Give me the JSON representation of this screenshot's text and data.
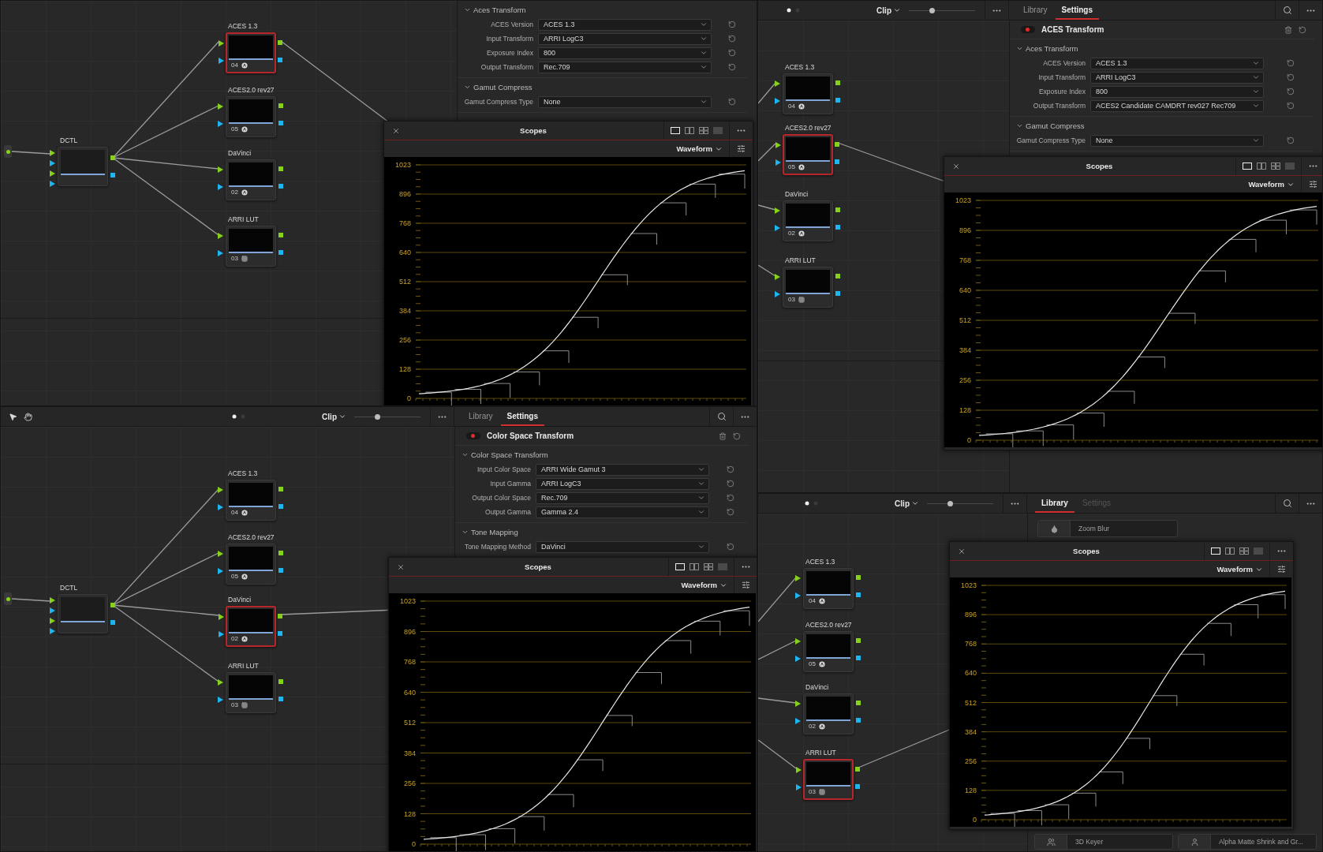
{
  "panels": [
    {
      "node_graph": {
        "source": {
          "label": "DCTL"
        },
        "nodes": [
          {
            "label": "ACES 1.3",
            "number": "04",
            "kind": "effect",
            "selected": true
          },
          {
            "label": "ACES2.0 rev27",
            "number": "05",
            "kind": "effect",
            "selected": false
          },
          {
            "label": "DaVinci",
            "number": "02",
            "kind": "effect",
            "selected": false
          },
          {
            "label": "ARRI LUT",
            "number": "03",
            "kind": "lut",
            "selected": false
          }
        ]
      },
      "settings": {
        "sections": [
          {
            "title": "Aces Transform",
            "expanded": true,
            "fields": [
              {
                "label": "ACES Version",
                "value": "ACES 1.3"
              },
              {
                "label": "Input Transform",
                "value": "ARRI LogC3"
              },
              {
                "label": "Exposure Index",
                "value": "800"
              },
              {
                "label": "Output Transform",
                "value": "Rec.709"
              }
            ]
          },
          {
            "title": "Gamut Compress",
            "expanded": true,
            "fields": [
              {
                "label": "Gamut Compress Type",
                "value": "None"
              }
            ]
          }
        ]
      },
      "scopes": {
        "title": "Scopes",
        "mode": "Waveform",
        "y_labels": [
          "1023",
          "896",
          "768",
          "640",
          "512",
          "384",
          "256",
          "128",
          "0"
        ]
      }
    },
    {
      "toolbar": {
        "view": "Clip",
        "slider": {
          "level": 0.35
        },
        "tabs": [
          {
            "label": "Library",
            "selected": false,
            "disabled": false
          },
          {
            "label": "Settings",
            "selected": true,
            "disabled": false
          }
        ]
      },
      "node_graph": {
        "nodes": [
          {
            "label": "ACES 1.3",
            "number": "04",
            "kind": "effect",
            "selected": false
          },
          {
            "label": "ACES2.0 rev27",
            "number": "05",
            "kind": "effect",
            "selected": true
          },
          {
            "label": "DaVinci",
            "number": "02",
            "kind": "effect",
            "selected": false
          },
          {
            "label": "ARRI LUT",
            "number": "03",
            "kind": "lut",
            "selected": false
          }
        ]
      },
      "settings": {
        "effect": {
          "title": "ACES Transform",
          "enabled": true
        },
        "sections": [
          {
            "title": "Aces Transform",
            "expanded": true,
            "fields": [
              {
                "label": "ACES Version",
                "value": "ACES 1.3"
              },
              {
                "label": "Input Transform",
                "value": "ARRI LogC3"
              },
              {
                "label": "Exposure Index",
                "value": "800"
              },
              {
                "label": "Output Transform",
                "value": "ACES2 Candidate CAMDRT rev027 Rec709"
              }
            ]
          },
          {
            "title": "Gamut Compress",
            "expanded": true,
            "fields": [
              {
                "label": "Gamut Compress Type",
                "value": "None"
              }
            ]
          }
        ]
      },
      "scopes": {
        "title": "Scopes",
        "mode": "Waveform",
        "y_labels": [
          "1023",
          "896",
          "768",
          "640",
          "512",
          "384",
          "256",
          "128",
          "0"
        ]
      }
    },
    {
      "toolbar": {
        "pointer_tools": true,
        "view": "Clip",
        "slider": {
          "level": 0.35
        },
        "tabs": [
          {
            "label": "Library",
            "selected": false,
            "disabled": false
          },
          {
            "label": "Settings",
            "selected": true,
            "disabled": false
          }
        ]
      },
      "node_graph": {
        "source": {
          "label": "DCTL"
        },
        "nodes": [
          {
            "label": "ACES 1.3",
            "number": "04",
            "kind": "effect",
            "selected": false
          },
          {
            "label": "ACES2.0 rev27",
            "number": "05",
            "kind": "effect",
            "selected": false
          },
          {
            "label": "DaVinci",
            "number": "02",
            "kind": "effect",
            "selected": true
          },
          {
            "label": "ARRI LUT",
            "number": "03",
            "kind": "lut",
            "selected": false
          }
        ]
      },
      "settings": {
        "effect": {
          "title": "Color Space Transform",
          "enabled": true
        },
        "sections": [
          {
            "title": "Color Space Transform",
            "expanded": true,
            "fields": [
              {
                "label": "Input Color Space",
                "value": "ARRI Wide Gamut 3"
              },
              {
                "label": "Input Gamma",
                "value": "ARRI LogC3"
              },
              {
                "label": "Output Color Space",
                "value": "Rec.709"
              },
              {
                "label": "Output Gamma",
                "value": "Gamma 2.4"
              }
            ]
          },
          {
            "title": "Tone Mapping",
            "expanded": true,
            "fields": [
              {
                "label": "Tone Mapping Method",
                "value": "DaVinci"
              }
            ]
          }
        ]
      },
      "scopes": {
        "title": "Scopes",
        "mode": "Waveform",
        "y_labels": [
          "1023",
          "896",
          "768",
          "640",
          "512",
          "384",
          "256",
          "128",
          "0"
        ]
      }
    },
    {
      "toolbar": {
        "view": "Clip",
        "slider": {
          "level": 0.35
        },
        "tabs": [
          {
            "label": "Library",
            "selected": true,
            "disabled": false
          },
          {
            "label": "Settings",
            "selected": false,
            "disabled": true
          }
        ]
      },
      "node_graph": {
        "nodes": [
          {
            "label": "ACES 1.3",
            "number": "04",
            "kind": "effect",
            "selected": false
          },
          {
            "label": "ACES2.0 rev27",
            "number": "05",
            "kind": "effect",
            "selected": false
          },
          {
            "label": "DaVinci",
            "number": "02",
            "kind": "effect",
            "selected": false
          },
          {
            "label": "ARRI LUT",
            "number": "03",
            "kind": "lut",
            "selected": true
          }
        ]
      },
      "library": {
        "items": [
          {
            "name": "Zoom Blur",
            "kind": "blur"
          }
        ],
        "lower_items": [
          {
            "name": "3D Keyer",
            "kind": "keyer"
          },
          {
            "name": "Alpha Matte Shrink and Gr...",
            "kind": "matte"
          }
        ]
      },
      "scopes": {
        "title": "Scopes",
        "mode": "Waveform",
        "y_labels": [
          "1023",
          "896",
          "768",
          "640",
          "512",
          "384",
          "256",
          "128",
          "0"
        ]
      }
    }
  ]
}
